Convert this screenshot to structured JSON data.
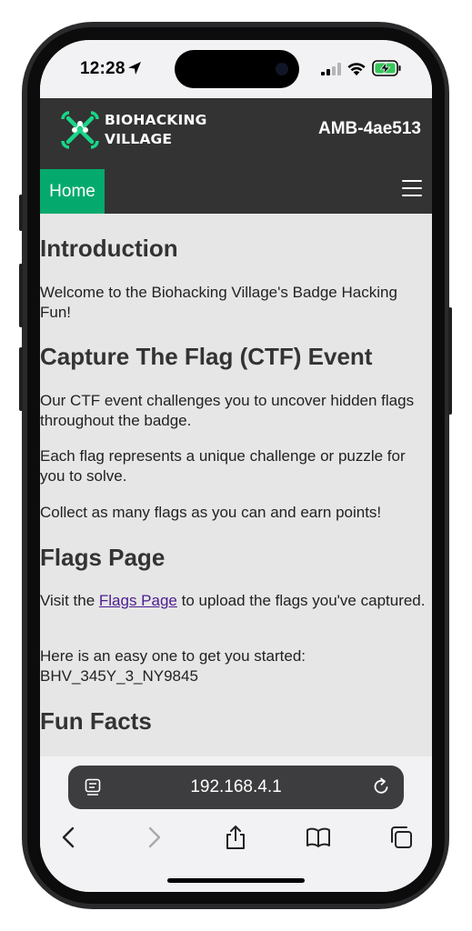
{
  "status_bar": {
    "time": "12:28",
    "icons": [
      "location-arrow-icon",
      "cellular-signal-icon",
      "wifi-icon",
      "battery-charging-icon"
    ]
  },
  "header": {
    "logo_line1": "BIOHACKING",
    "logo_line2": "VILLAGE",
    "logo_icon": "crossed-wrench-molecule-icon",
    "device_id": "AMB-4ae513"
  },
  "nav": {
    "home_label": "Home",
    "menu_icon": "hamburger-menu-icon"
  },
  "content": {
    "intro_heading": "Introduction",
    "intro_text": "Welcome to the Biohacking Village's Badge Hacking Fun!",
    "ctf_heading": "Capture The Flag (CTF) Event",
    "ctf_p1": "Our CTF event challenges you to uncover hidden flags throughout the badge.",
    "ctf_p2": "Each flag represents a unique challenge or puzzle for you to solve.",
    "ctf_p3": "Collect as many flags as you can and earn points!",
    "flags_heading": "Flags Page",
    "flags_text_before": "Visit the ",
    "flags_link": "Flags Page",
    "flags_text_after": " to upload the flags you've captured.",
    "easy_text": "Here is an easy one to get you started:",
    "easy_flag": "BHV_345Y_3_NY9845",
    "facts_heading": "Fun Facts"
  },
  "browser": {
    "url": "192.168.4.1",
    "toolbar": [
      "back-icon",
      "forward-icon",
      "share-icon",
      "bookmarks-icon",
      "tabs-icon"
    ]
  },
  "colors": {
    "header_bg": "#333333",
    "nav_active": "#04aa6d",
    "content_bg": "#e6e6e6",
    "logo_green": "#18d68a",
    "link": "#4b1d91"
  }
}
